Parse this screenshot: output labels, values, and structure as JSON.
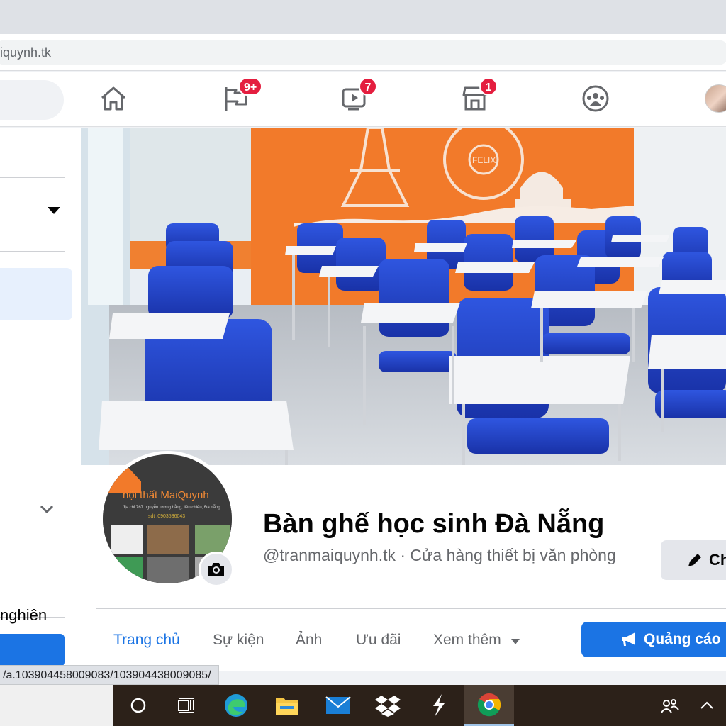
{
  "browser": {
    "url": "iquynh.tk",
    "status_url": "/a.103904458009083/103904438009085/"
  },
  "header": {
    "nav": [
      {
        "name": "home",
        "badge": ""
      },
      {
        "name": "pages-flag",
        "badge": "9+"
      },
      {
        "name": "watch",
        "badge": "7"
      },
      {
        "name": "marketplace",
        "badge": "1"
      },
      {
        "name": "groups",
        "badge": ""
      }
    ]
  },
  "sidebar": {
    "partial_text": "nghiên"
  },
  "cover": {
    "sign_text": "FELIX"
  },
  "profile": {
    "logo_title": "nội thất MaiQuynh",
    "logo_address": "địa chỉ 767 nguyễn lương bằng, liên chiểu, Đà nẵng",
    "logo_phone": "sdt :0903536043",
    "name": "Bàn ghế học sinh Đà Nẵng",
    "subtitle": "@tranmaiquynh.tk · Cửa hàng thiết bị văn phòng",
    "edit_label": "Ch"
  },
  "tabs": [
    {
      "label": "Trang chủ",
      "active": true
    },
    {
      "label": "Sự kiện",
      "active": false
    },
    {
      "label": "Ảnh",
      "active": false
    },
    {
      "label": "Ưu đãi",
      "active": false
    },
    {
      "label": "Xem thêm",
      "active": false
    }
  ],
  "ad_button": "Quảng cáo",
  "colors": {
    "accent": "#1b74e4",
    "badge": "#e41e3f",
    "wall_orange": "#f27a2a",
    "chair_blue": "#1f3fc4"
  }
}
